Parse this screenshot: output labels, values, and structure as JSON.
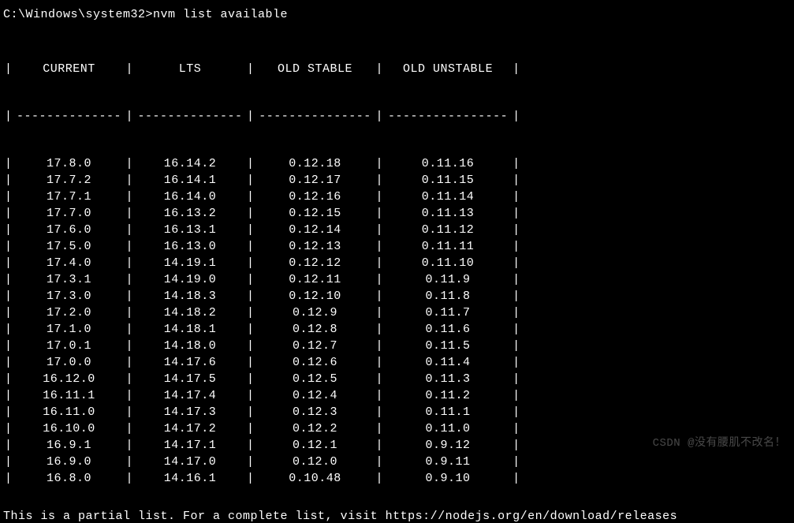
{
  "prompt": {
    "path": "C:\\Windows\\system32>",
    "command": "nvm list available"
  },
  "table": {
    "headers": [
      "CURRENT",
      "LTS",
      "OLD STABLE",
      "OLD UNSTABLE"
    ],
    "rows": [
      [
        "17.8.0",
        "16.14.2",
        "0.12.18",
        "0.11.16"
      ],
      [
        "17.7.2",
        "16.14.1",
        "0.12.17",
        "0.11.15"
      ],
      [
        "17.7.1",
        "16.14.0",
        "0.12.16",
        "0.11.14"
      ],
      [
        "17.7.0",
        "16.13.2",
        "0.12.15",
        "0.11.13"
      ],
      [
        "17.6.0",
        "16.13.1",
        "0.12.14",
        "0.11.12"
      ],
      [
        "17.5.0",
        "16.13.0",
        "0.12.13",
        "0.11.11"
      ],
      [
        "17.4.0",
        "14.19.1",
        "0.12.12",
        "0.11.10"
      ],
      [
        "17.3.1",
        "14.19.0",
        "0.12.11",
        "0.11.9"
      ],
      [
        "17.3.0",
        "14.18.3",
        "0.12.10",
        "0.11.8"
      ],
      [
        "17.2.0",
        "14.18.2",
        "0.12.9",
        "0.11.7"
      ],
      [
        "17.1.0",
        "14.18.1",
        "0.12.8",
        "0.11.6"
      ],
      [
        "17.0.1",
        "14.18.0",
        "0.12.7",
        "0.11.5"
      ],
      [
        "17.0.0",
        "14.17.6",
        "0.12.6",
        "0.11.4"
      ],
      [
        "16.12.0",
        "14.17.5",
        "0.12.5",
        "0.11.3"
      ],
      [
        "16.11.1",
        "14.17.4",
        "0.12.4",
        "0.11.2"
      ],
      [
        "16.11.0",
        "14.17.3",
        "0.12.3",
        "0.11.1"
      ],
      [
        "16.10.0",
        "14.17.2",
        "0.12.2",
        "0.11.0"
      ],
      [
        "16.9.1",
        "14.17.1",
        "0.12.1",
        "0.9.12"
      ],
      [
        "16.9.0",
        "14.17.0",
        "0.12.0",
        "0.9.11"
      ],
      [
        "16.8.0",
        "14.16.1",
        "0.10.48",
        "0.9.10"
      ]
    ]
  },
  "footer_text": "This is a partial list. For a complete list, visit https://nodejs.org/en/download/releases",
  "watermark": "CSDN @没有腰肌不改名！"
}
